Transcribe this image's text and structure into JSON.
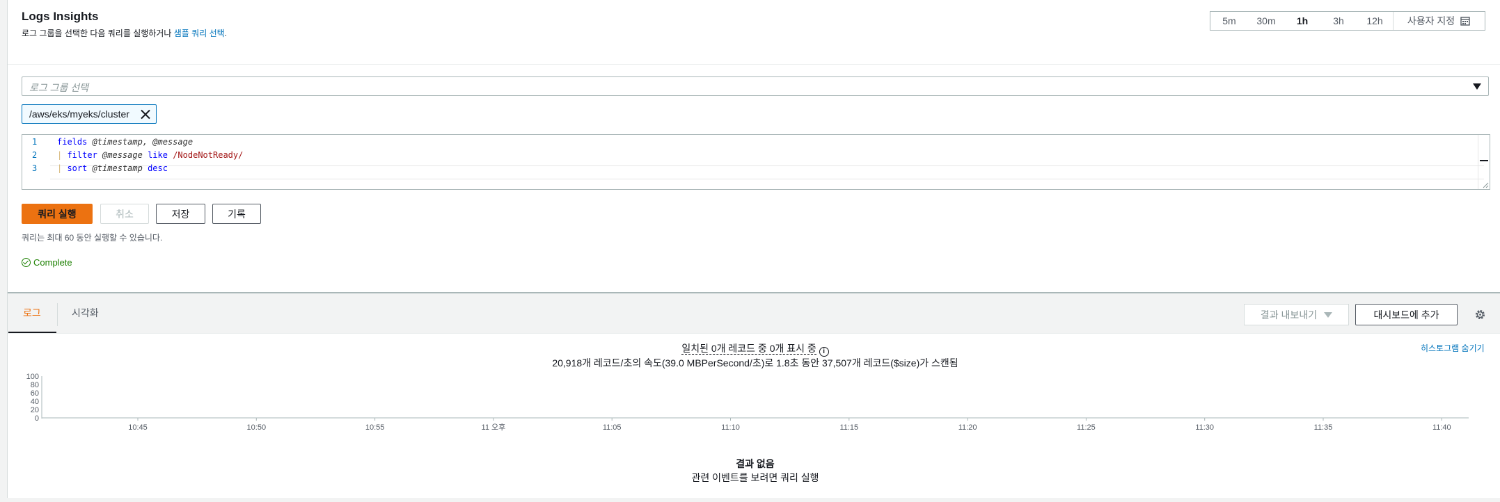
{
  "header": {
    "title": "Logs Insights",
    "subtitle_text": "로그 그룹을 선택한 다음 쿼리를 실행하거나 ",
    "subtitle_link": "샘플 쿼리 선택",
    "subtitle_end": "."
  },
  "time_range": {
    "options": [
      "5m",
      "30m",
      "1h",
      "3h",
      "12h"
    ],
    "selected": "1h",
    "custom_label": "사용자 지정"
  },
  "log_group_select": {
    "placeholder": "로그 그룹 선택"
  },
  "selected_groups": [
    "/aws/eks/myeks/cluster"
  ],
  "query": {
    "line_numbers": [
      "1",
      "2",
      "3"
    ],
    "line1_kw": "fields",
    "line1_rest": " @timestamp, @message",
    "line2_pipe": "|",
    "line2_kw": " filter",
    "line2_var": " @message",
    "line2_op": " like",
    "line2_rx": " /NodeNotReady/",
    "line3_pipe": "|",
    "line3_kw": " sort",
    "line3_var": " @timestamp",
    "line3_dir": " desc"
  },
  "actions": {
    "run": "쿼리 실행",
    "cancel": "취소",
    "save": "저장",
    "history": "기록"
  },
  "hint": "쿼리는 최대 60 동안 실행할 수 있습니다.",
  "status": "Complete",
  "results_tabs": {
    "logs": "로그",
    "visualization": "시각화",
    "export": "결과 내보내기",
    "add_dashboard": "대시보드에 추가"
  },
  "summary": {
    "matched": "일치된 0개 레코드 중 0개 표시 중",
    "info_glyph": "i",
    "scan": "20,918개 레코드/초의 속도(39.0 MBPerSecond/초)로 1.8초 동안 37,507개 레코드($size)가 스캔됨",
    "hide_histogram": "히스토그램 숨기기"
  },
  "chart_data": {
    "type": "bar",
    "categories": [
      "10:45",
      "10:50",
      "10:55",
      "11 오후",
      "11:05",
      "11:10",
      "11:15",
      "11:20",
      "11:25",
      "11:30",
      "11:35",
      "11:40"
    ],
    "values": [
      0,
      0,
      0,
      0,
      0,
      0,
      0,
      0,
      0,
      0,
      0,
      0
    ],
    "yticks": [
      "100",
      "80",
      "60",
      "40",
      "20",
      "0"
    ],
    "ylim": [
      0,
      100
    ]
  },
  "empty": {
    "title": "결과 없음",
    "message": "관련 이벤트를 보려면 쿼리 실행"
  },
  "colors": {
    "accent": "#ec7211",
    "link": "#0073bb",
    "success": "#1d8102"
  }
}
